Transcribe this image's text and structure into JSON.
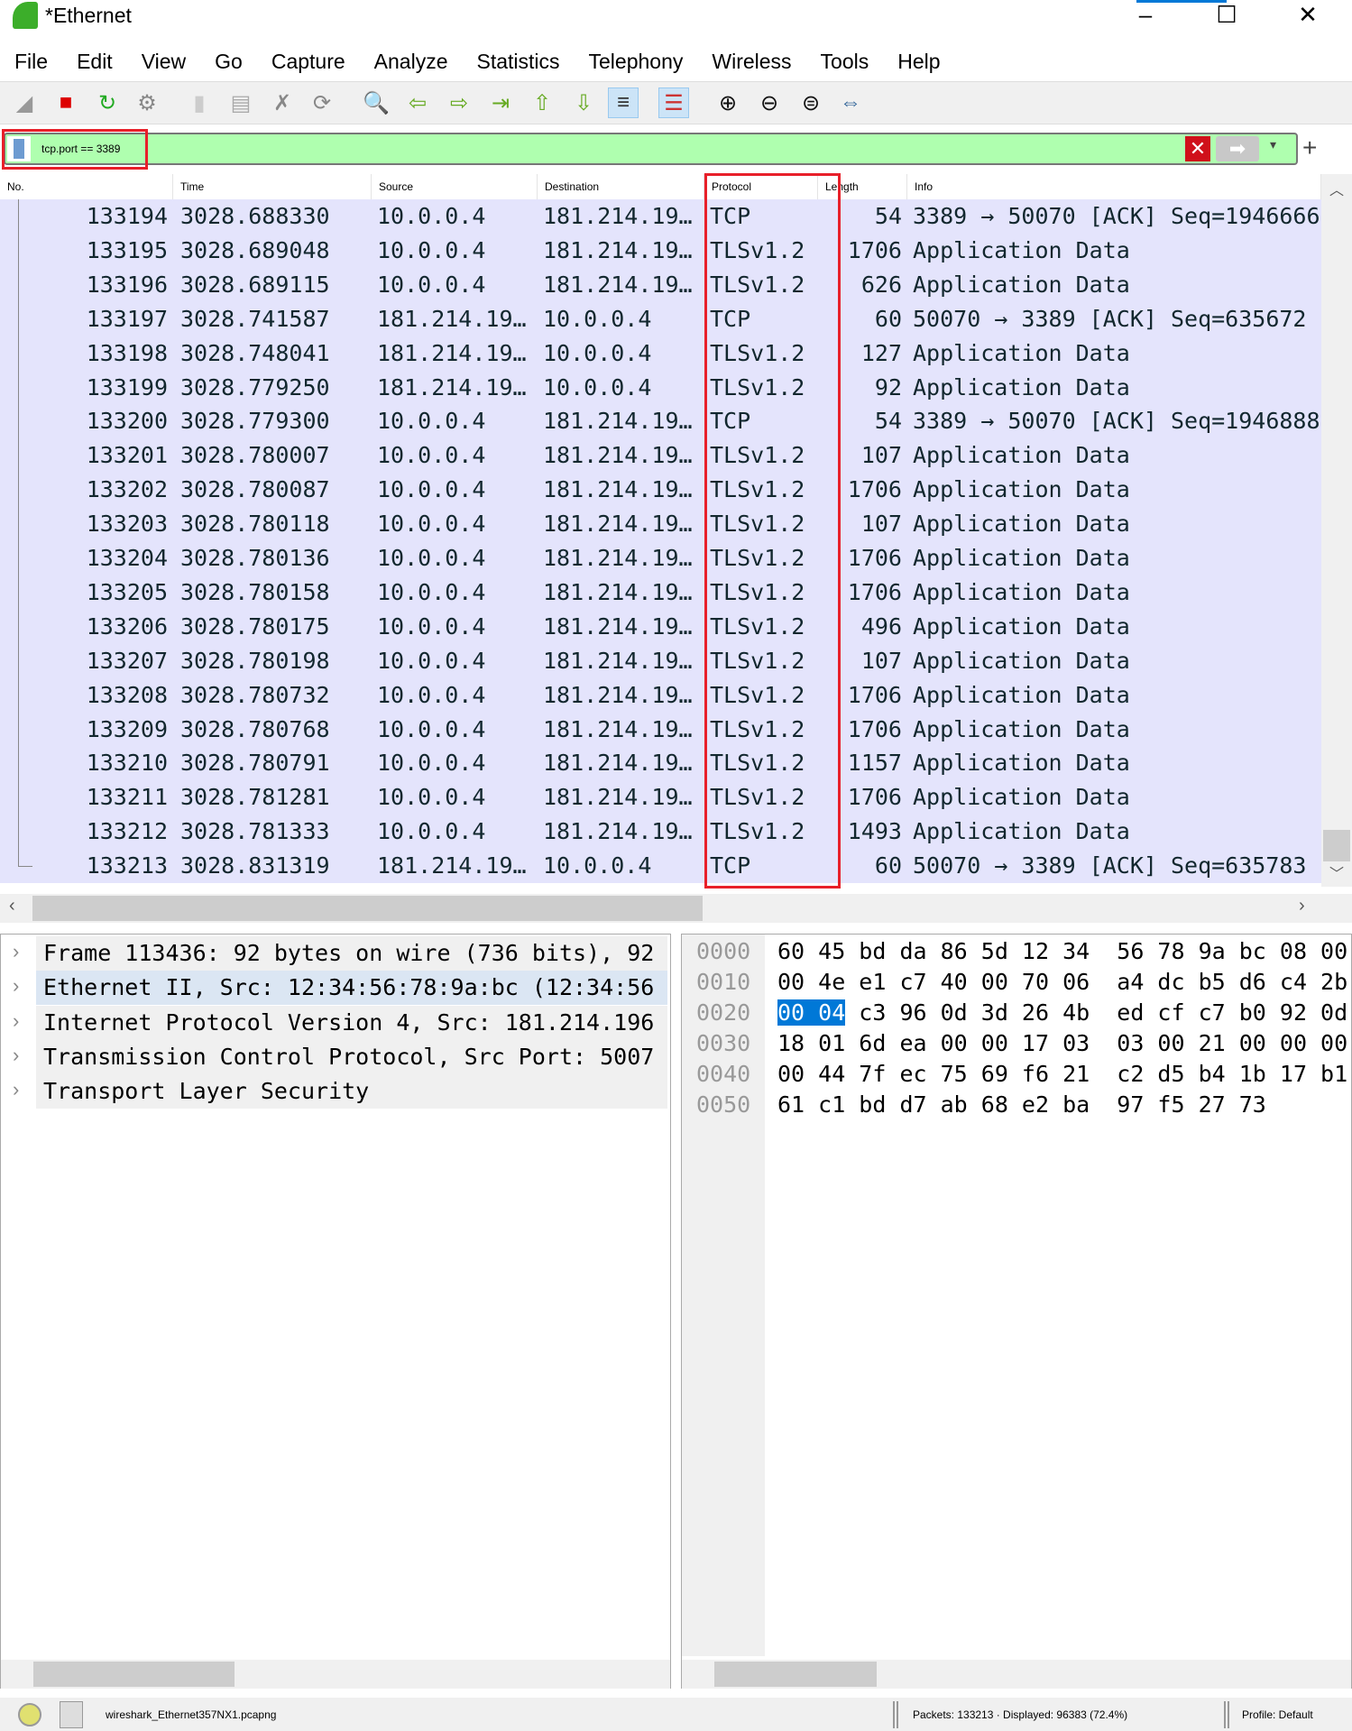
{
  "window": {
    "title": "*Ethernet",
    "minimize": "–",
    "maximize": "☐",
    "close": "✕"
  },
  "menu": [
    "File",
    "Edit",
    "View",
    "Go",
    "Capture",
    "Analyze",
    "Statistics",
    "Telephony",
    "Wireless",
    "Tools",
    "Help"
  ],
  "toolbar": [
    "shark-fin-icon",
    "stop-icon",
    "restart-icon",
    "options-gear-icon",
    "open-icon",
    "file-icon",
    "close-file-icon",
    "reload-icon",
    "find-icon",
    "back-icon",
    "forward-icon",
    "goto-icon",
    "first-icon",
    "last-icon",
    "autoscroll-icon",
    "colorize-icon",
    "zoom-in-icon",
    "zoom-out-icon",
    "zoom-normal-icon",
    "resize-columns-icon"
  ],
  "filter": {
    "value": "tcp.port == 3389",
    "clear": "✕",
    "apply": "➡",
    "dropdown": "▾",
    "add": "+"
  },
  "columns": [
    "No.",
    "Time",
    "Source",
    "Destination",
    "Protocol",
    "Length",
    "Info"
  ],
  "packets": [
    [
      "133194",
      "3028.688330",
      "10.0.0.4",
      "181.214.19…",
      "TCP",
      "54",
      "3389 → 50070 [ACK] Seq=1946666"
    ],
    [
      "133195",
      "3028.689048",
      "10.0.0.4",
      "181.214.19…",
      "TLSv1.2",
      "1706",
      "Application Data"
    ],
    [
      "133196",
      "3028.689115",
      "10.0.0.4",
      "181.214.19…",
      "TLSv1.2",
      "626",
      "Application Data"
    ],
    [
      "133197",
      "3028.741587",
      "181.214.19…",
      "10.0.0.4",
      "TCP",
      "60",
      "50070 → 3389 [ACK] Seq=635672"
    ],
    [
      "133198",
      "3028.748041",
      "181.214.19…",
      "10.0.0.4",
      "TLSv1.2",
      "127",
      "Application Data"
    ],
    [
      "133199",
      "3028.779250",
      "181.214.19…",
      "10.0.0.4",
      "TLSv1.2",
      "92",
      "Application Data"
    ],
    [
      "133200",
      "3028.779300",
      "10.0.0.4",
      "181.214.19…",
      "TCP",
      "54",
      "3389 → 50070 [ACK] Seq=1946888"
    ],
    [
      "133201",
      "3028.780007",
      "10.0.0.4",
      "181.214.19…",
      "TLSv1.2",
      "107",
      "Application Data"
    ],
    [
      "133202",
      "3028.780087",
      "10.0.0.4",
      "181.214.19…",
      "TLSv1.2",
      "1706",
      "Application Data"
    ],
    [
      "133203",
      "3028.780118",
      "10.0.0.4",
      "181.214.19…",
      "TLSv1.2",
      "107",
      "Application Data"
    ],
    [
      "133204",
      "3028.780136",
      "10.0.0.4",
      "181.214.19…",
      "TLSv1.2",
      "1706",
      "Application Data"
    ],
    [
      "133205",
      "3028.780158",
      "10.0.0.4",
      "181.214.19…",
      "TLSv1.2",
      "1706",
      "Application Data"
    ],
    [
      "133206",
      "3028.780175",
      "10.0.0.4",
      "181.214.19…",
      "TLSv1.2",
      "496",
      "Application Data"
    ],
    [
      "133207",
      "3028.780198",
      "10.0.0.4",
      "181.214.19…",
      "TLSv1.2",
      "107",
      "Application Data"
    ],
    [
      "133208",
      "3028.780732",
      "10.0.0.4",
      "181.214.19…",
      "TLSv1.2",
      "1706",
      "Application Data"
    ],
    [
      "133209",
      "3028.780768",
      "10.0.0.4",
      "181.214.19…",
      "TLSv1.2",
      "1706",
      "Application Data"
    ],
    [
      "133210",
      "3028.780791",
      "10.0.0.4",
      "181.214.19…",
      "TLSv1.2",
      "1157",
      "Application Data"
    ],
    [
      "133211",
      "3028.781281",
      "10.0.0.4",
      "181.214.19…",
      "TLSv1.2",
      "1706",
      "Application Data"
    ],
    [
      "133212",
      "3028.781333",
      "10.0.0.4",
      "181.214.19…",
      "TLSv1.2",
      "1493",
      "Application Data"
    ],
    [
      "133213",
      "3028.831319",
      "181.214.19…",
      "10.0.0.4",
      "TCP",
      "60",
      "50070 → 3389 [ACK] Seq=635783"
    ]
  ],
  "details": [
    "Frame 113436: 92 bytes on wire (736 bits), 92",
    "Ethernet II, Src: 12:34:56:78:9a:bc (12:34:56",
    "Internet Protocol Version 4, Src: 181.214.196",
    "Transmission Control Protocol, Src Port: 5007",
    "Transport Layer Security"
  ],
  "hex": {
    "offsets": [
      "0000",
      "0010",
      "0020",
      "0030",
      "0040",
      "0050"
    ],
    "lines": [
      "60 45 bd da 86 5d 12 34  56 78 9a bc 08 00",
      "00 4e e1 c7 40 00 70 06  a4 dc b5 d6 c4 2b",
      "00 04 c3 96 0d 3d 26 4b  ed cf c7 b0 92 0d",
      "18 01 6d ea 00 00 17 03  03 00 21 00 00 00",
      "00 44 7f ec 75 69 f6 21  c2 d5 b4 1b 17 b1",
      "61 c1 bd d7 ab 68 e2 ba  97 f5 27 73"
    ],
    "selected": "00 04"
  },
  "status": {
    "file": "wireshark_Ethernet357NX1.pcapng",
    "packets": "Packets: 133213 · Displayed: 96383 (72.4%)",
    "profile": "Profile: Default"
  },
  "colors": {
    "row_bg": "#e4e4fc",
    "filter_bg": "#afffaf",
    "highlight": "#e8202a",
    "selection": "#0078d7"
  }
}
